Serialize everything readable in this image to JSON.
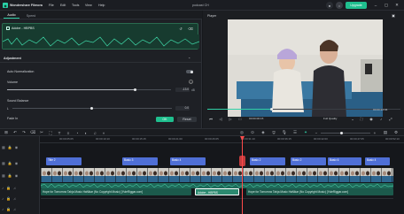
{
  "app": {
    "title": "Wondershare Filmora",
    "project_name": "podcast CH",
    "menu": [
      "File",
      "Edit",
      "Tools",
      "View",
      "Help"
    ],
    "upgrade_label": "Upgrade"
  },
  "left_panel": {
    "tabs": [
      "Audio",
      "Speed"
    ],
    "clip_name": "Adobe - HBPBS",
    "adjustment_label": "Adjustment",
    "auto_norm_label": "Auto Normalization",
    "volume_label": "Volume",
    "volume_value": "-13.0",
    "volume_unit": "dB",
    "sound_balance_label": "Sound Balance",
    "balance_left": "L",
    "balance_value": "0.0",
    "fade_in_label": "Fade In",
    "ok_label": "OK",
    "reset_label": "Reset"
  },
  "player": {
    "label": "Player",
    "time_current": "00:00:24:04",
    "time_total": "00:00:00:15",
    "quality": "Full Quality"
  },
  "timeline": {
    "ruler": [
      "00:00:05:05",
      "00:00:10:10",
      "00:00:15:15",
      "00:00:21:00",
      "00:00:26:05",
      "00:00:31:10",
      "00:00:36:15",
      "00:00:42:00",
      "00:00:47:05",
      "00:00:52:10"
    ],
    "title_clips": [
      "Title 2",
      "Basic 3",
      "Basic 4",
      "Basic 2",
      "Basic 2",
      "Basic 6",
      "Basic 4"
    ],
    "audio_clips": [
      "Hope for Tomorrow Tahja Music HaNikar (No Copyright Music) [YuleRiggar.com]",
      "Adobe - HBPBS",
      "Hope for Tomorrow Tahja Music HaNikar (No Copyright Music) [YuleRiggar.com]"
    ]
  },
  "colors": {
    "accent": "#2fd0a6",
    "playhead": "#ff4a4a",
    "title_clip": "#4f6fd6",
    "audio_clip": "#1f6b5a",
    "upgrade": "#1fbf8e"
  }
}
